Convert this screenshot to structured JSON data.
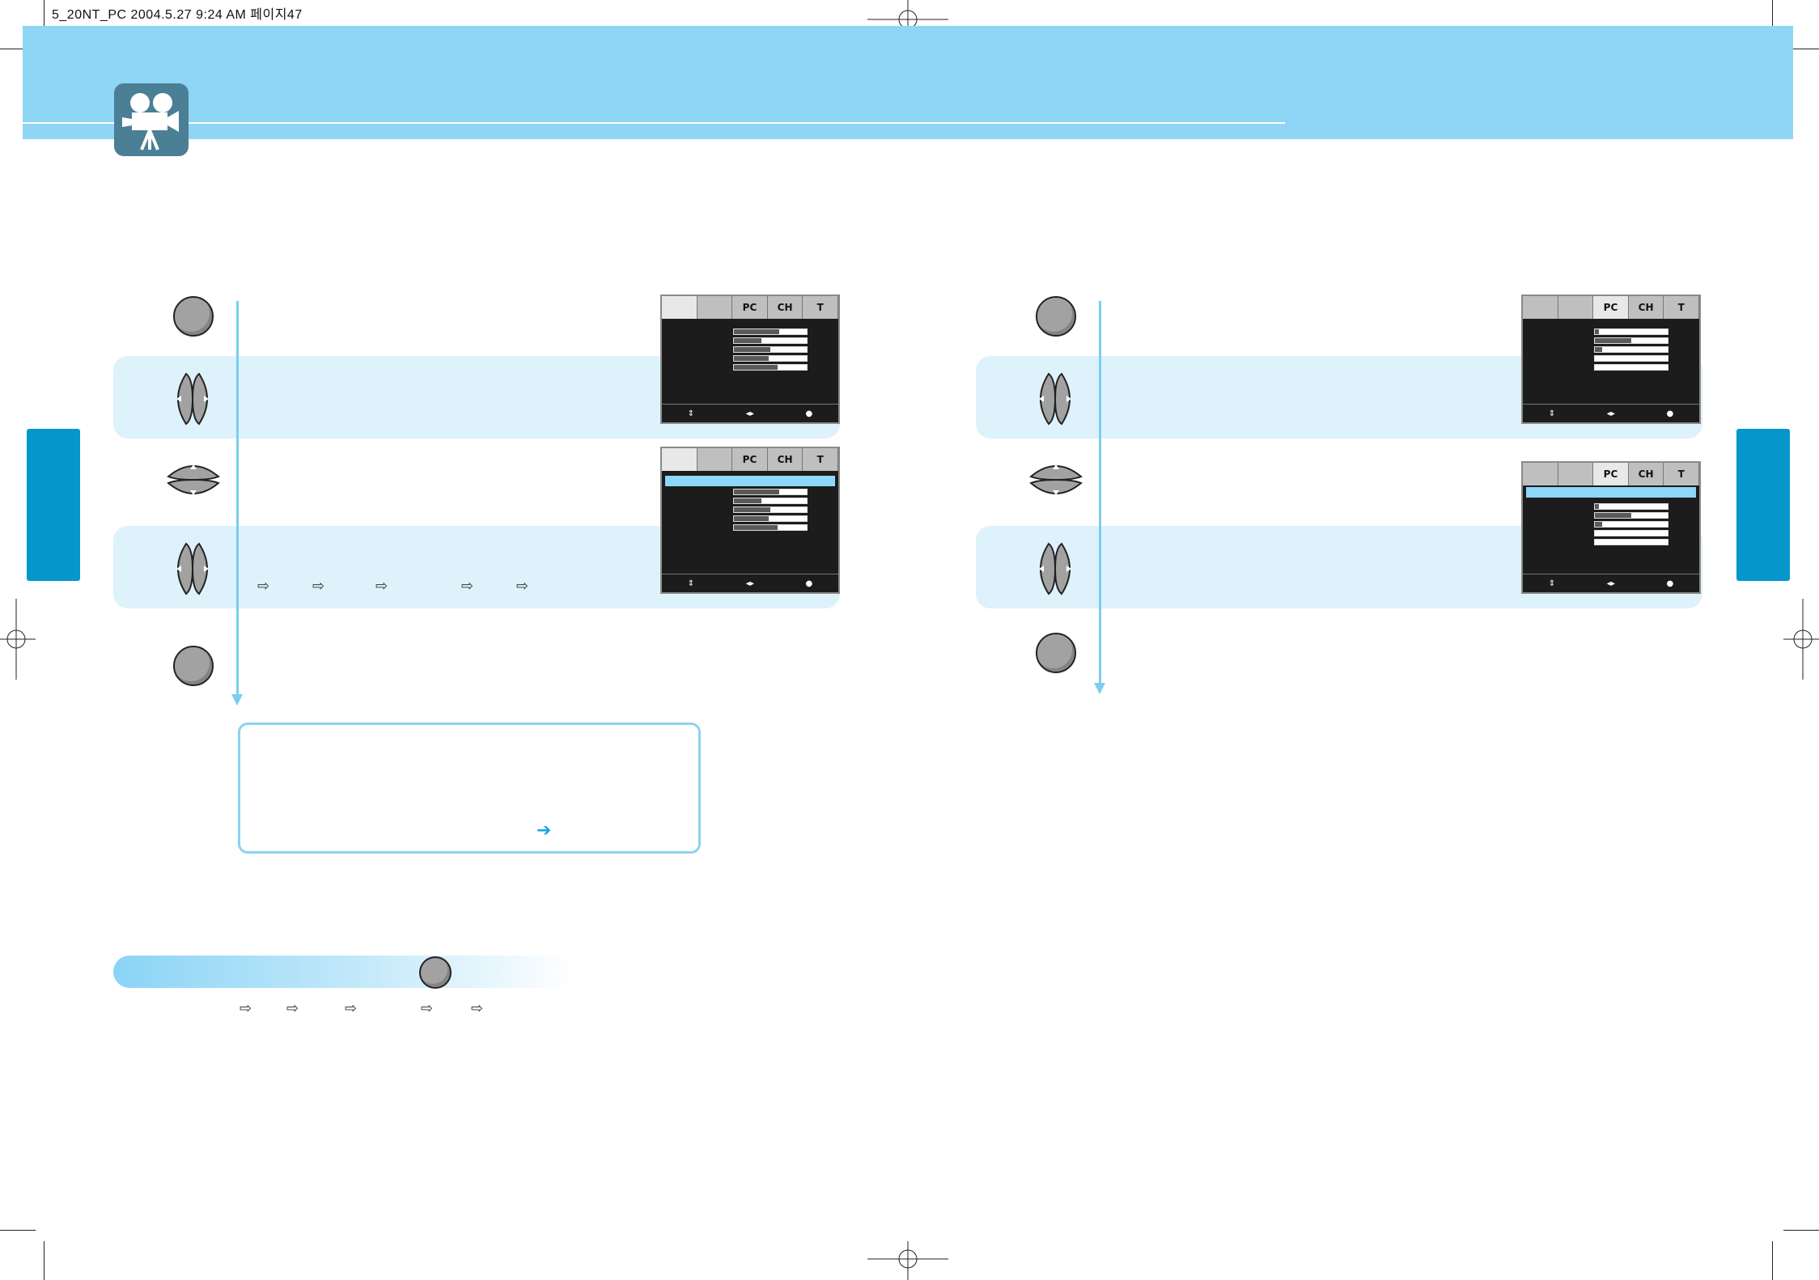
{
  "slug": {
    "text": "5_20NT_PC  2004.5.27 9:24 AM 페이지47"
  },
  "colors": {
    "band": "#8fd6f6",
    "accent": "#0596cc",
    "stripe": "#def2fb",
    "line": "#7ccdf0",
    "button": "#a2a2a2"
  },
  "header": {
    "icon": "movie-camera-icon"
  },
  "left": {
    "osd1": {
      "tab_labels": [
        "",
        "",
        "PC",
        "CH",
        "T"
      ],
      "selected_tab": 0,
      "bar_levels": [
        0.62,
        0.38,
        0.5,
        0.48,
        0.6
      ],
      "footer": [
        "⇕",
        "◂▸",
        "●"
      ]
    },
    "osd2": {
      "tab_labels": [
        "",
        "",
        "PC",
        "CH",
        "T"
      ],
      "selected_tab": 0,
      "bar_levels": [
        0.62,
        0.38,
        0.5,
        0.48,
        0.6
      ],
      "footer": [
        "⇕",
        "◂▸",
        "●"
      ]
    },
    "step_arrows": [
      "⇨",
      "⇨",
      "⇨",
      "⇨",
      "⇨"
    ],
    "note": {
      "arrow": "➔"
    }
  },
  "right": {
    "osd1": {
      "tab_labels": [
        "",
        "",
        "PC",
        "CH",
        "T"
      ],
      "selected_tab": 2,
      "bar_levels": [
        0.05,
        0.5,
        0.1,
        0.0,
        0.0
      ],
      "footer": [
        "⇕",
        "◂▸",
        "●"
      ]
    },
    "osd2": {
      "tab_labels": [
        "",
        "",
        "PC",
        "CH",
        "T"
      ],
      "selected_tab": 2,
      "bar_levels": [
        0.05,
        0.5,
        0.1,
        0.0,
        0.0
      ],
      "footer": [
        "⇕",
        "◂▸",
        "●"
      ]
    }
  },
  "bottom": {
    "sequence_arrows": [
      "⇨",
      "⇨",
      "⇨",
      "⇨",
      "⇨"
    ]
  }
}
